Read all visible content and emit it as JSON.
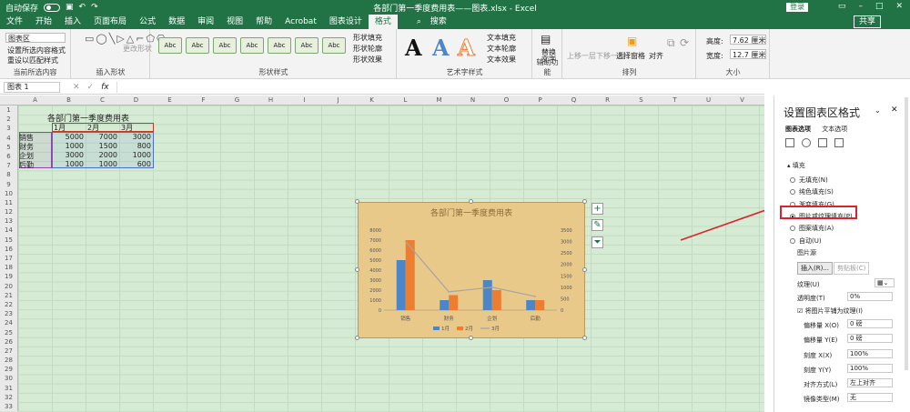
{
  "titlebar": {
    "autosave": "自动保存",
    "doc_title": "各部门第一季度费用表——图表.xlsx - Excel",
    "login": "登录"
  },
  "menu": {
    "items": [
      "文件",
      "开始",
      "插入",
      "页面布局",
      "公式",
      "数据",
      "审阅",
      "视图",
      "帮助",
      "Acrobat",
      "图表设计",
      "格式"
    ],
    "search": "搜索",
    "share": "共享"
  },
  "ribbon": {
    "selection": {
      "dropdown": "图表区",
      "format_sel": "设置所选内容格式",
      "reset": "重设以匹配样式",
      "label": "当前所选内容"
    },
    "insert_shapes": {
      "change": "更改形状",
      "label": "插入形状"
    },
    "shape_styles": {
      "btn": "Abc",
      "fill": "形状填充",
      "outline": "形状轮廓",
      "effect": "形状效果",
      "label": "形状样式"
    },
    "wordart": {
      "letter": "A",
      "fill": "文本填充",
      "outline": "文本轮廓",
      "effect": "文本效果",
      "label": "艺术字样式"
    },
    "accessibility": {
      "alt": "替换文字",
      "label": "辅助功能"
    },
    "arrange": {
      "forward": "上移一层",
      "backward": "下移一层",
      "pane": "选择窗格",
      "align": "对齐",
      "label": "排列"
    },
    "size": {
      "height_label": "高度:",
      "height": "7.62 厘米",
      "width_label": "宽度:",
      "width": "12.7 厘米",
      "label": "大小"
    }
  },
  "formula": {
    "namebox": "图表 1",
    "fx": "fx"
  },
  "sheet": {
    "columns": [
      "A",
      "B",
      "C",
      "D",
      "E",
      "F",
      "G",
      "H",
      "I",
      "J",
      "K",
      "L",
      "M",
      "N",
      "O",
      "P",
      "Q",
      "R",
      "S",
      "T",
      "U",
      "V"
    ],
    "rows": [
      "1",
      "2",
      "3",
      "4",
      "5",
      "6",
      "7",
      "8",
      "9",
      "10",
      "11",
      "12",
      "13",
      "14",
      "15",
      "16",
      "17",
      "18",
      "19",
      "20",
      "21",
      "22",
      "23",
      "24",
      "25",
      "26",
      "27",
      "28",
      "29",
      "30",
      "31",
      "32",
      "33"
    ],
    "title": "各部门第一季度费用表",
    "headers": [
      "1月",
      "2月",
      "3月"
    ],
    "data": [
      [
        "销售",
        "5000",
        "7000",
        "3000"
      ],
      [
        "财务",
        "1000",
        "1500",
        "800"
      ],
      [
        "企划",
        "3000",
        "2000",
        "1000"
      ],
      [
        "后勤",
        "1000",
        "1000",
        "600"
      ]
    ]
  },
  "chart_data": {
    "type": "bar",
    "title": "各部门第一季度费用表",
    "categories": [
      "销售",
      "财务",
      "企划",
      "后勤"
    ],
    "series": [
      {
        "name": "1月",
        "values": [
          5000,
          1000,
          3000,
          1000
        ],
        "kind": "bar",
        "color": "#4a86c8"
      },
      {
        "name": "2月",
        "values": [
          7000,
          1500,
          2000,
          1000
        ],
        "kind": "bar",
        "color": "#ed7d31"
      },
      {
        "name": "3月",
        "values": [
          3000,
          800,
          1000,
          600
        ],
        "kind": "line",
        "axis": "secondary",
        "color": "#a5a5a5"
      }
    ],
    "ylim": [
      0,
      8000
    ],
    "yticks": [
      "0",
      "1000",
      "2000",
      "3000",
      "4000",
      "5000",
      "6000",
      "7000",
      "8000"
    ],
    "y2lim": [
      0,
      3500
    ],
    "y2ticks": [
      "0",
      "500",
      "1000",
      "1500",
      "2000",
      "2500",
      "3000",
      "3500"
    ],
    "legend": "bottom"
  },
  "panel": {
    "title": "设置图表区格式",
    "tabs": [
      "图表选项",
      "文本选项"
    ],
    "section": "填充",
    "options": [
      "无填充(N)",
      "纯色填充(S)",
      "渐变填充(G)",
      "图片或纹理填充(P)",
      "图案填充(A)",
      "自动(U)"
    ],
    "picture_source": "图片源",
    "insert": "插入(R)...",
    "clipboard": "剪贴板(C)",
    "texture": "纹理(U)",
    "transparency": "透明度(T)",
    "transparency_val": "0%",
    "tile": "将图片平铺为纹理(I)",
    "offset_x": "偏移量 X(O)",
    "offset_x_val": "0 磅",
    "offset_y": "偏移量 Y(E)",
    "offset_y_val": "0 磅",
    "scale_x": "刻度 X(X)",
    "scale_x_val": "100%",
    "scale_y": "刻度 Y(Y)",
    "scale_y_val": "100%",
    "align": "对齐方式(L)",
    "align_val": "左上对齐",
    "mirror": "镜像类型(M)",
    "mirror_val": "无"
  },
  "colors": {
    "excel_green": "#217346",
    "sheet_bg": "#d5ebd4",
    "chart_bg": "#e8c98a",
    "highlight": "#d9232d"
  }
}
